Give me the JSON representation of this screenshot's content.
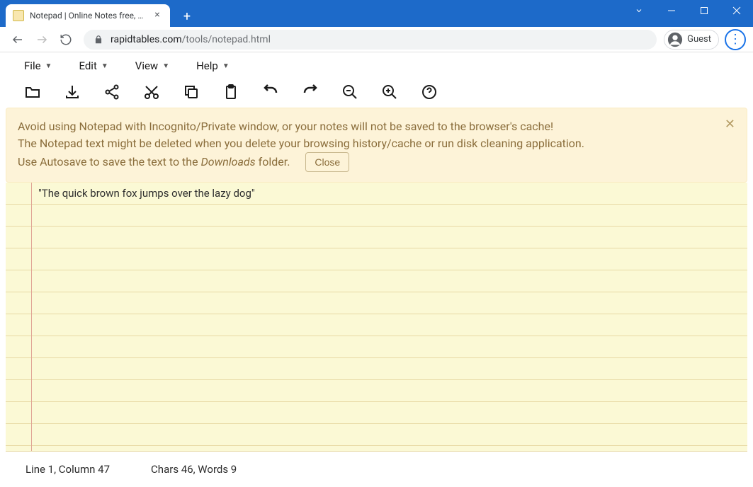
{
  "browser": {
    "tab_title": "Notepad | Online Notes free, no",
    "url_host": "rapidtables.com",
    "url_path": "/tools/notepad.html",
    "guest_label": "Guest"
  },
  "menus": {
    "file": "File",
    "edit": "Edit",
    "view": "View",
    "help": "Help"
  },
  "toolbar_icons": {
    "open": "folder-open-icon",
    "save": "download-icon",
    "share": "share-icon",
    "cut": "cut-icon",
    "copy": "copy-icon",
    "paste": "paste-icon",
    "undo": "undo-icon",
    "redo": "redo-icon",
    "zoom_out": "zoom-out-icon",
    "zoom_in": "zoom-in-icon",
    "help": "help-icon"
  },
  "alert": {
    "line1": "Avoid using Notepad with Incognito/Private window, or your notes will not be saved to the browser's cache!",
    "line2": "The Notepad text might be deleted when you delete your browsing history/cache or run disk cleaning application.",
    "line3_prefix": "Use Autosave to save the text to the ",
    "line3_italic": "Downloads",
    "line3_suffix": " folder.",
    "close_label": "Close"
  },
  "editor": {
    "lines": [
      "\"The quick brown fox jumps over the lazy dog\"",
      "",
      "",
      "",
      "",
      "",
      "",
      "",
      "",
      "",
      "",
      ""
    ]
  },
  "status": {
    "line_col": "Line 1, Column 47",
    "chars_words": "Chars 46, Words 9"
  }
}
